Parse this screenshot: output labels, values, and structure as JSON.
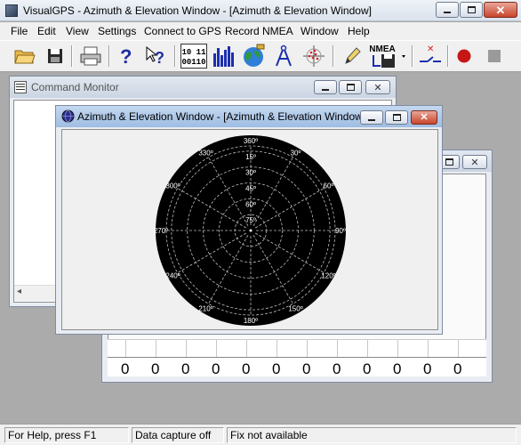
{
  "app": {
    "title": "VisualGPS - Azimuth & Elevation Window - [Azimuth & Elevation Window]"
  },
  "menu": [
    "File",
    "Edit",
    "View",
    "Settings",
    "Connect to GPS",
    "Record NMEA",
    "Window",
    "Help"
  ],
  "toolbar": {
    "nmea_label": "NMEA",
    "binary_label_top": "10 11",
    "binary_label_bottom": "00110"
  },
  "command_monitor": {
    "title": "Command Monitor"
  },
  "az_window": {
    "title": "Azimuth & Elevation Window - [Azimuth & Elevation Window]",
    "elevation_labels": [
      "15º",
      "30º",
      "45º",
      "60º",
      "75º"
    ],
    "azimuth_labels": [
      "360º",
      "30º",
      "60º",
      "90º",
      "120º",
      "150º",
      "180º",
      "210º",
      "240º",
      "270º",
      "300º",
      "330º"
    ]
  },
  "signal_window": {
    "values": [
      "0",
      "0",
      "0",
      "0",
      "0",
      "0",
      "0",
      "0",
      "0",
      "0",
      "0",
      "0"
    ]
  },
  "status_bar": {
    "help": "For Help, press F1",
    "capture": "Data capture off",
    "fix": "Fix not available"
  }
}
